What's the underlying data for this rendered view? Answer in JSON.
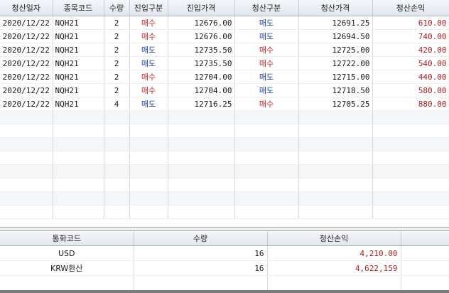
{
  "trade_table": {
    "columns": [
      "청산일자",
      "종목코드",
      "수량",
      "진입구분",
      "진입가격",
      "청산구분",
      "청산가격",
      "청산손익"
    ],
    "rows": [
      {
        "date": "2020/12/22",
        "code": "NQH21",
        "qty": "2",
        "entry_side": "매수",
        "entry_price": "12676.00",
        "exit_side": "매도",
        "exit_price": "12691.25",
        "pnl": "610.00"
      },
      {
        "date": "2020/12/22",
        "code": "NQH21",
        "qty": "2",
        "entry_side": "매수",
        "entry_price": "12676.00",
        "exit_side": "매도",
        "exit_price": "12694.50",
        "pnl": "740.00"
      },
      {
        "date": "2020/12/22",
        "code": "NQH21",
        "qty": "2",
        "entry_side": "매도",
        "entry_price": "12735.50",
        "exit_side": "매수",
        "exit_price": "12725.00",
        "pnl": "420.00"
      },
      {
        "date": "2020/12/22",
        "code": "NQH21",
        "qty": "2",
        "entry_side": "매도",
        "entry_price": "12735.50",
        "exit_side": "매수",
        "exit_price": "12722.00",
        "pnl": "540.00"
      },
      {
        "date": "2020/12/22",
        "code": "NQH21",
        "qty": "2",
        "entry_side": "매수",
        "entry_price": "12704.00",
        "exit_side": "매도",
        "exit_price": "12715.00",
        "pnl": "440.00"
      },
      {
        "date": "2020/12/22",
        "code": "NQH21",
        "qty": "2",
        "entry_side": "매수",
        "entry_price": "12704.00",
        "exit_side": "매도",
        "exit_price": "12718.50",
        "pnl": "580.00"
      },
      {
        "date": "2020/12/22",
        "code": "NQH21",
        "qty": "4",
        "entry_side": "매도",
        "entry_price": "12716.25",
        "exit_side": "매수",
        "exit_price": "12705.25",
        "pnl": "880.00"
      }
    ],
    "empty_rows": 8
  },
  "summary_table": {
    "columns": [
      "통화코드",
      "수량",
      "청산손익"
    ],
    "rows": [
      {
        "currency": "USD",
        "qty": "16",
        "pnl": "4,210.00"
      },
      {
        "currency": "KRW환산",
        "qty": "16",
        "pnl": "4,622,159"
      }
    ]
  },
  "colors": {
    "buy": "#cc2222",
    "sell": "#1c3cb4",
    "pnl": "#b31d1d"
  }
}
